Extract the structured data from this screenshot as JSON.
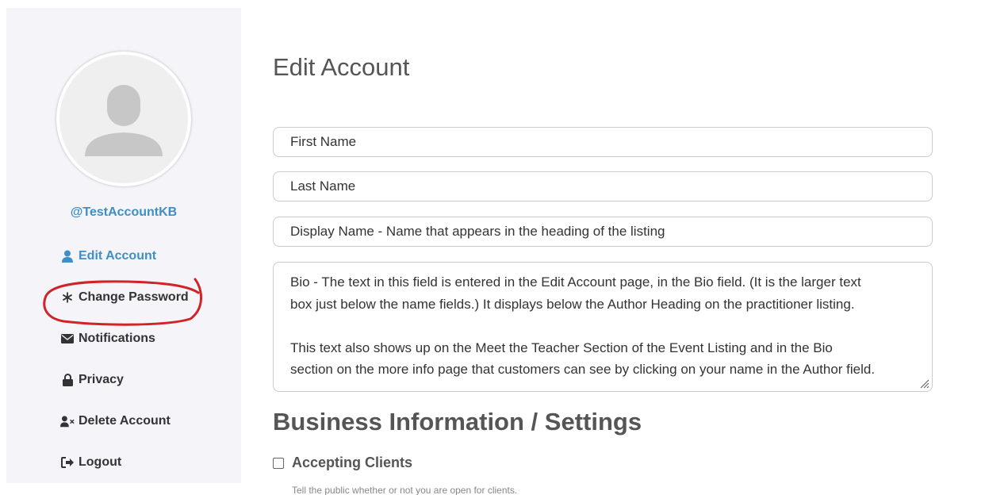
{
  "sidebar": {
    "username": "@TestAccountKB",
    "nav": [
      {
        "label": "Edit Account",
        "icon": "user-icon"
      },
      {
        "label": "Change Password",
        "icon": "asterisk-icon"
      },
      {
        "label": "Notifications",
        "icon": "envelope-icon"
      },
      {
        "label": "Privacy",
        "icon": "lock-icon"
      },
      {
        "label": "Delete Account",
        "icon": "user-remove-icon"
      },
      {
        "label": "Logout",
        "icon": "logout-icon"
      }
    ]
  },
  "main": {
    "title": "Edit Account",
    "fields": {
      "first_name": "First Name",
      "last_name": "Last Name",
      "display_name": "Display Name - Name that appears in the heading of the listing"
    },
    "bio": {
      "line1": "Bio - The text in this field is entered in the Edit Account page, in the Bio field. (It is the larger text",
      "line2": "box just below the name fields.) It displays below the Author Heading on the practitioner listing.",
      "line3": "This text also shows up on the Meet the Teacher Section of the Event Listing and in the Bio",
      "line4": "section on the more info page that customers can see by clicking on your name in the Author field."
    },
    "section_title": "Business Information / Settings",
    "accepting_clients": {
      "label": "Accepting Clients",
      "checked": false,
      "help": "Tell the public whether or not you are open for clients."
    }
  },
  "colors": {
    "accent": "#3f8fc5",
    "annotation": "#d0232a"
  }
}
